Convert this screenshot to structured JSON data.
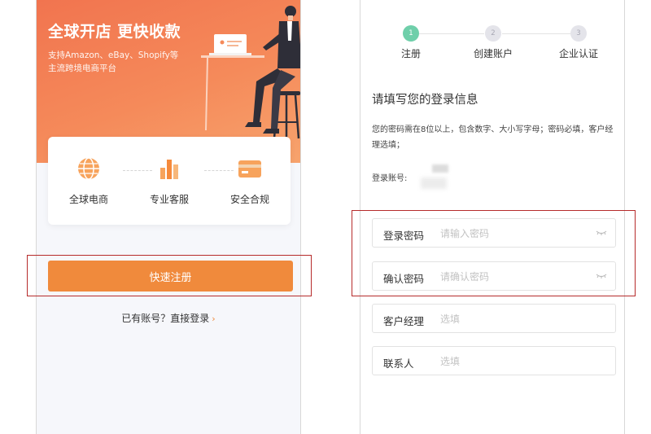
{
  "left_screen": {
    "hero": {
      "title": "全球开店 更快收款",
      "subtitle": "支持Amazon、eBay、Shopify等主流跨境电商平台"
    },
    "features": [
      {
        "icon": "globe-icon",
        "label": "全球电商"
      },
      {
        "icon": "service-icon",
        "label": "专业客服"
      },
      {
        "icon": "card-icon",
        "label": "安全合规"
      }
    ],
    "register_button": "快速注册",
    "login_prompt": "已有账号？直接登录",
    "login_arrow": "›"
  },
  "right_screen": {
    "steps": [
      {
        "number": "1",
        "label": "注册",
        "active": true
      },
      {
        "number": "2",
        "label": "创建账户",
        "active": false
      },
      {
        "number": "3",
        "label": "企业认证",
        "active": false
      }
    ],
    "form_title": "请填写您的登录信息",
    "password_rules": "您的密码需在8位以上，包含数字、大小写字母；密码必填，客户经理选填；",
    "account_label": "登录账号:",
    "fields": {
      "password": {
        "label": "登录密码",
        "placeholder": "请输入密码"
      },
      "confirm_password": {
        "label": "确认密码",
        "placeholder": "请确认密码"
      },
      "account_manager": {
        "label": "客户经理",
        "placeholder": "选填"
      },
      "contact": {
        "label": "联系人",
        "placeholder": "选填"
      }
    }
  },
  "colors": {
    "brand_orange": "#f08a3c",
    "hero_gradient_start": "#f1744f",
    "step_active": "#6fcfaa",
    "highlight_red": "#b62b2b"
  }
}
